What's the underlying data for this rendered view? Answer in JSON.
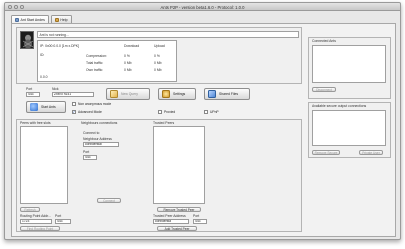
{
  "window": {
    "title": "Ants P2P - version beta1.6.0 - Protocol: 1.0.0"
  },
  "tabs": [
    {
      "label": "Ant Start Andes"
    },
    {
      "label": "Help"
    }
  ],
  "status": {
    "message": "Ant is not running...",
    "ip_text": "IP: 0x00:0.0.0 [1m x.DPK]",
    "id_label": "ID:",
    "id_value": "",
    "hash_value": "0.0.0",
    "columns": {
      "download": "Download",
      "upload": "Upload"
    },
    "rows": [
      {
        "label": "Compression:",
        "download": "0 %",
        "upload": "0 %"
      },
      {
        "label": "Total traffic:",
        "download": "0 Mb",
        "upload": "0 Mb"
      },
      {
        "label": "Own traffic:",
        "download": "0 Mb",
        "upload": "0 Mb"
      }
    ]
  },
  "network": {
    "port_label": "Port",
    "port_value": "443",
    "nick_label": "Nick",
    "nick_value": "ZxxNTh141"
  },
  "buttons": {
    "start": "Start Ants",
    "new_query": "New Query",
    "settings": "Settings",
    "shared_files": "Shared Files"
  },
  "options": {
    "anonymous": "Non anonymous mode",
    "advanced": "Advanced Mode",
    "proxied": "Proxied",
    "upnp": "UPnP"
  },
  "peers_with_free_slots": {
    "title": "Peers with free slots",
    "refresh": "Refresh",
    "routing_label": "Routing Point Addr...",
    "routing_value": "1723",
    "port_label": "Port",
    "port_value": "443",
    "find_button": "Find Routing Point"
  },
  "neighbours": {
    "title": "Neighbours connections",
    "connect_to": "Connect to",
    "address_label": "Neighbour Address",
    "address_value": "confidential",
    "port_label": "Port",
    "port_value": "443",
    "connect_button": "Connect"
  },
  "trusted": {
    "title": "Trusted Peers",
    "remove_button": "Remove Trusted Peer",
    "address_label": "Trusted Peer Address",
    "port_label": "Port",
    "address_value": "confidentia",
    "port_value": "443",
    "add_button": "Add Trusted Peer"
  },
  "connected_ants": {
    "title": "Connected Ants",
    "disconnect": "Disconnect"
  },
  "secure_output": {
    "title": "Available secure output connections",
    "remove_secure": "Remove Secure",
    "private_user": "Private User"
  }
}
